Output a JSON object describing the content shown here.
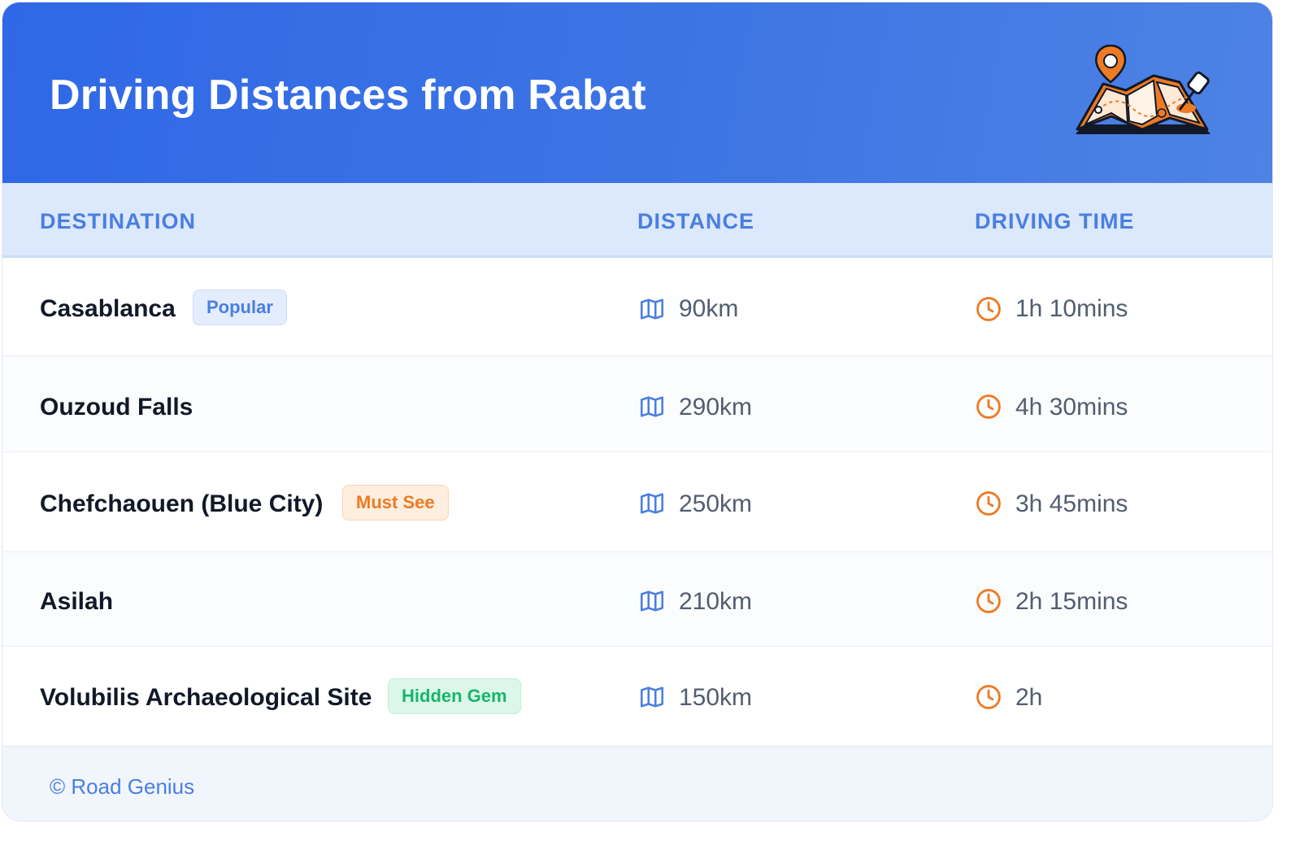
{
  "header": {
    "title": "Driving Distances from Rabat"
  },
  "table": {
    "columns": [
      "DESTINATION",
      "DISTANCE",
      "DRIVING TIME"
    ],
    "rows": [
      {
        "destination": "Casablanca",
        "badge": "Popular",
        "badge_color": "#4a7fe0",
        "distance": "90km",
        "time": "1h 10mins"
      },
      {
        "destination": "Ouzoud Falls",
        "badge": "",
        "distance": "290km",
        "time": "4h 30mins"
      },
      {
        "destination": "Chefchaouen (Blue City)",
        "badge": "Must See",
        "badge_color": "#ee7a24",
        "distance": "250km",
        "time": "3h 45mins"
      },
      {
        "destination": "Asilah",
        "badge": "",
        "distance": "210km",
        "time": "2h 15mins"
      },
      {
        "destination": "Volubilis Archaeological Site",
        "badge": "Hidden Gem",
        "badge_color": "#18b56a",
        "distance": "150km",
        "time": "2h"
      }
    ],
    "distance_icon": "map-icon",
    "time_icon": "clock-icon"
  },
  "footer": {
    "credit": "© Road Genius"
  },
  "colors": {
    "header_blue": "#2f68e6",
    "accent_blue": "#4a7fe0",
    "accent_orange": "#ee7a24"
  }
}
